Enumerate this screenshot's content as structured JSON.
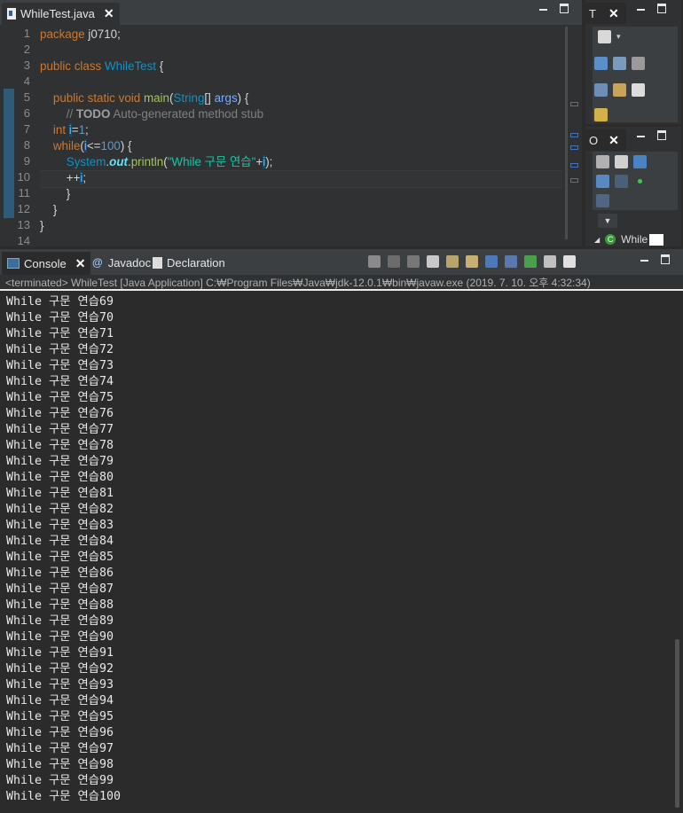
{
  "editor": {
    "tab_title": "WhileTest.java",
    "line_numbers": [
      "1",
      "2",
      "3",
      "4",
      "5",
      "6",
      "7",
      "8",
      "9",
      "10",
      "11",
      "12",
      "13",
      "14"
    ],
    "lines": {
      "l1": {
        "kw": "package",
        "rest": " j0710;"
      },
      "l3": {
        "kw1": "public",
        "kw2": "class",
        "cls": "WhileTest",
        "rest": " {"
      },
      "l5": {
        "kw1": "public",
        "kw2": "static",
        "kw3": "void",
        "fn": "main",
        "type": "String",
        "arr": "[] ",
        "arg": "args",
        "rest": ") {"
      },
      "l6": {
        "comment": "// ",
        "todo": "TODO",
        "comment_rest": " Auto-generated method stub"
      },
      "l7": {
        "kw": "int",
        "var": "i",
        "eq": "=",
        "num": "1",
        "end": ";"
      },
      "l8": {
        "kw": "while",
        "open": "(",
        "var": "i",
        "op": "<=",
        "num": "100",
        "close": ") {"
      },
      "l9": {
        "obj": "System",
        "dot1": ".",
        "field": "out",
        "dot2": ".",
        "method": "println",
        "open": "(",
        "str": "\"While 구문 연습\"",
        "plus": "+",
        "var": "i",
        "close": ");"
      },
      "l10": {
        "op": "++",
        "var": "i",
        "end": ";"
      },
      "l11": {
        "text": "}"
      },
      "l12": {
        "text": "}"
      },
      "l13": {
        "text": "}"
      }
    }
  },
  "right_views": {
    "top_tab": "T",
    "bottom_tab": "O",
    "outline_item": "While"
  },
  "console": {
    "tabs": [
      "Console",
      "Javadoc",
      "Declaration"
    ],
    "status": "<terminated> WhileTest [Java Application] C:₩Program Files₩Java₩jdk-12.0.1₩bin₩javaw.exe (2019. 7. 10. 오후 4:32:34)",
    "output_lines": [
      "While 구문 연습69",
      "While 구문 연습70",
      "While 구문 연습71",
      "While 구문 연습72",
      "While 구문 연습73",
      "While 구문 연습74",
      "While 구문 연습75",
      "While 구문 연습76",
      "While 구문 연습77",
      "While 구문 연습78",
      "While 구문 연습79",
      "While 구문 연습80",
      "While 구문 연습81",
      "While 구문 연습82",
      "While 구문 연습83",
      "While 구문 연습84",
      "While 구문 연습85",
      "While 구문 연습86",
      "While 구문 연습87",
      "While 구문 연습88",
      "While 구문 연습89",
      "While 구문 연습90",
      "While 구문 연습91",
      "While 구문 연습92",
      "While 구문 연습93",
      "While 구문 연습94",
      "While 구문 연습95",
      "While 구문 연습96",
      "While 구문 연습97",
      "While 구문 연습98",
      "While 구문 연습99",
      "While 구문 연습100"
    ]
  },
  "colors": {
    "keyword": "#cc7832",
    "class": "#1290c3",
    "method": "#a5c25c",
    "string": "#17c6a3",
    "number": "#6897bb"
  }
}
